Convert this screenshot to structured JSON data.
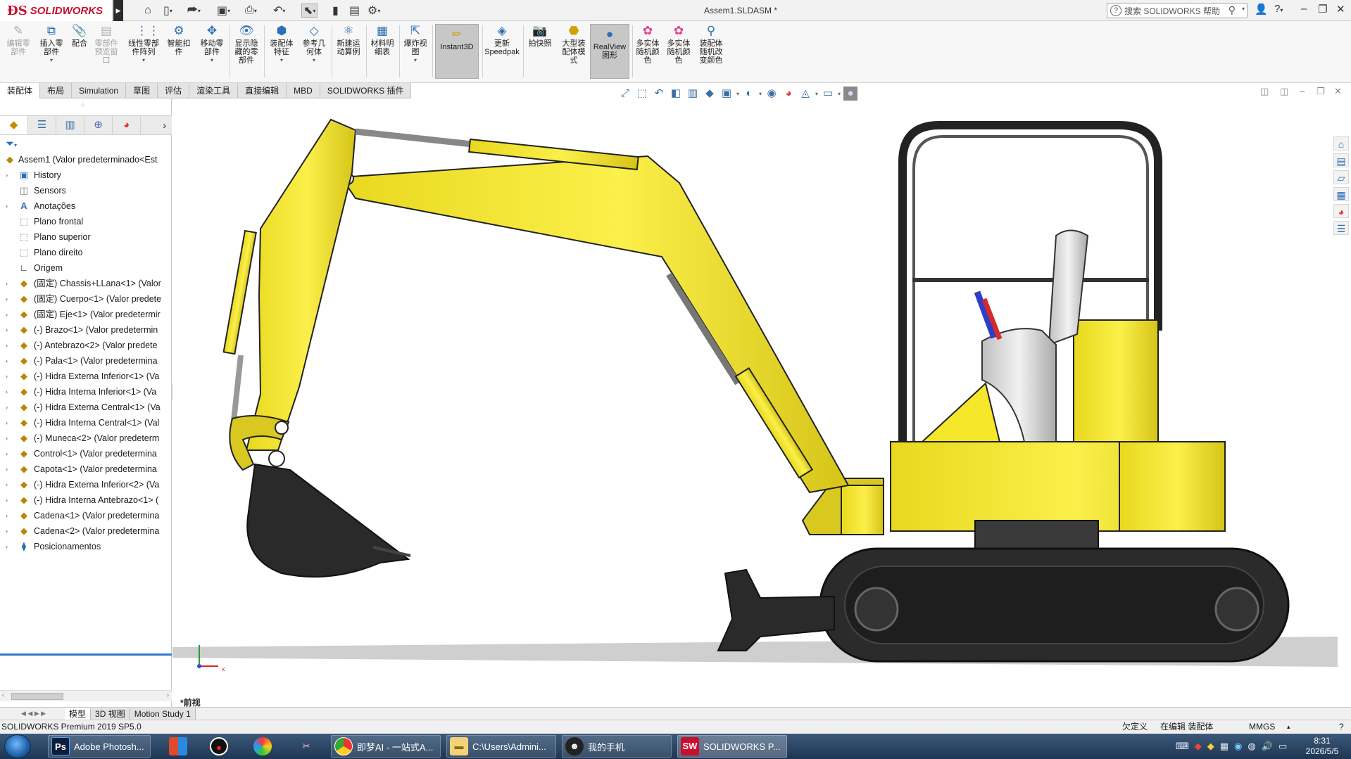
{
  "titlebar": {
    "brand": "SOLIDWORKS",
    "document_title": "Assem1.SLDASM *",
    "help_search_placeholder": "搜索 SOLIDWORKS 帮助",
    "quick_access_icons": [
      "home-icon",
      "new-file-icon",
      "open-file-icon",
      "save-icon",
      "print-icon",
      "undo-icon",
      "select-icon",
      "traffic-light-icon",
      "file-properties-icon",
      "options-icon"
    ],
    "window_controls": [
      "user-icon",
      "help-icon",
      "minimize-icon",
      "restore-icon",
      "close-icon"
    ]
  },
  "command_manager": {
    "commands": [
      {
        "label": "编辑零\n部件",
        "enabled": false
      },
      {
        "label": "插入零\n部件",
        "enabled": true
      },
      {
        "label": "配合",
        "enabled": true
      },
      {
        "label": "零部件\n预览窗\n口",
        "enabled": false
      },
      {
        "label": "线性零部\n件阵列",
        "enabled": true
      },
      {
        "label": "智能扣\n件",
        "enabled": true
      },
      {
        "label": "移动零\n部件",
        "enabled": true
      },
      {
        "label": "显示隐\n藏的零\n部件",
        "enabled": true
      },
      {
        "label": "装配体\n特征",
        "enabled": true
      },
      {
        "label": "参考几\n何体",
        "enabled": true
      },
      {
        "label": "新建运\n动算例",
        "enabled": true
      },
      {
        "label": "材料明\n细表",
        "enabled": true
      },
      {
        "label": "爆炸视\n图",
        "enabled": true
      },
      {
        "label": "Instant3D",
        "enabled": true
      },
      {
        "label": "更新\nSpeedpak",
        "enabled": true
      },
      {
        "label": "拍快照",
        "enabled": true
      },
      {
        "label": "大型装\n配体模\n式",
        "enabled": true
      },
      {
        "label": "RealView\n图形",
        "enabled": true
      },
      {
        "label": "多实体\n随机颜\n色",
        "enabled": true
      },
      {
        "label": "多实体\n随机颜\n色",
        "enabled": true
      },
      {
        "label": "装配体\n随机改\n变颜色",
        "enabled": true
      }
    ]
  },
  "tabs": [
    "装配体",
    "布局",
    "Simulation",
    "草图",
    "评估",
    "渲染工具",
    "直接编辑",
    "MBD",
    "SOLIDWORKS 插件"
  ],
  "active_tab": "装配体",
  "feature_tree": {
    "root": "Assem1  (Valor predeterminado<Est",
    "items": [
      {
        "label": "History",
        "icon": "history-folder-icon",
        "expandable": true
      },
      {
        "label": "Sensors",
        "icon": "sensor-icon",
        "expandable": false
      },
      {
        "label": "Anotações",
        "icon": "annotations-icon",
        "expandable": true
      },
      {
        "label": "Plano frontal",
        "icon": "plane-icon",
        "expandable": false
      },
      {
        "label": "Plano superior",
        "icon": "plane-icon",
        "expandable": false
      },
      {
        "label": "Plano direito",
        "icon": "plane-icon",
        "expandable": false
      },
      {
        "label": "Origem",
        "icon": "origin-icon",
        "expandable": false
      },
      {
        "label": "(固定) Chassis+LLana<1> (Valor",
        "icon": "part-icon",
        "expandable": true
      },
      {
        "label": "(固定) Cuerpo<1> (Valor predete",
        "icon": "part-icon",
        "expandable": true
      },
      {
        "label": "(固定) Eje<1> (Valor predetermir",
        "icon": "part-icon",
        "expandable": true
      },
      {
        "label": "(-) Brazo<1> (Valor predetermin",
        "icon": "part-icon",
        "expandable": true
      },
      {
        "label": "(-) Antebrazo<2> (Valor predete",
        "icon": "part-icon",
        "expandable": true
      },
      {
        "label": "(-) Pala<1> (Valor predetermina",
        "icon": "part-icon",
        "expandable": true
      },
      {
        "label": "(-) Hidra Externa Inferior<1> (Va",
        "icon": "part-icon",
        "expandable": true
      },
      {
        "label": "(-) Hidra Interna Inferior<1> (Va",
        "icon": "part-icon",
        "expandable": true
      },
      {
        "label": "(-) Hidra Externa Central<1> (Va",
        "icon": "part-icon",
        "expandable": true
      },
      {
        "label": "(-) Hidra Interna Central<1> (Val",
        "icon": "part-icon",
        "expandable": true
      },
      {
        "label": "(-) Muneca<2> (Valor predeterm",
        "icon": "part-icon",
        "expandable": true
      },
      {
        "label": "Control<1> (Valor predetermina",
        "icon": "part-icon",
        "expandable": true
      },
      {
        "label": "Capota<1> (Valor predetermina",
        "icon": "part-icon",
        "expandable": true
      },
      {
        "label": "(-) Hidra Externa Inferior<2> (Va",
        "icon": "part-icon",
        "expandable": true
      },
      {
        "label": "(-) Hidra Interna Antebrazo<1> (",
        "icon": "part-icon",
        "expandable": true
      },
      {
        "label": "Cadena<1> (Valor predetermina",
        "icon": "part-icon",
        "expandable": true
      },
      {
        "label": "Cadena<2> (Valor predetermina",
        "icon": "part-icon",
        "expandable": true
      },
      {
        "label": "Posicionamentos",
        "icon": "mates-icon",
        "expandable": true
      }
    ]
  },
  "viewport": {
    "view_name": "*前视",
    "triad_x": "x",
    "body_color": "#f5e72a",
    "track_color": "#2a2a2a"
  },
  "bottom_tabs": [
    "模型",
    "3D 视图",
    "Motion Study 1"
  ],
  "status": {
    "product": "SOLIDWORKS Premium 2019 SP5.0",
    "definition": "欠定义",
    "editing": "在编辑 装配体",
    "units": "MMGS"
  },
  "taskbar": {
    "apps": [
      {
        "label": "Adobe Photosh...",
        "icon": "photoshop-icon"
      },
      {
        "label": "即梦AI - 一站式A...",
        "icon": "chrome-icon"
      },
      {
        "label": "C:\\Users\\Admini...",
        "icon": "folder-icon"
      },
      {
        "label": "我的手机",
        "icon": "qq-icon"
      },
      {
        "label": "SOLIDWORKS P...",
        "icon": "solidworks-icon"
      }
    ],
    "time": "8:31",
    "date": "2026/5/5"
  }
}
